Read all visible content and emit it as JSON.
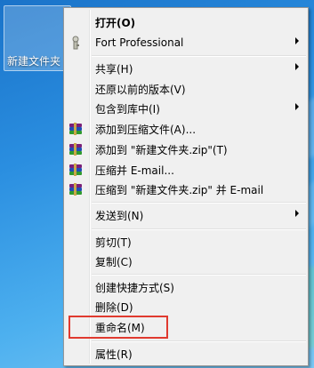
{
  "desktop": {
    "folder_label": "新建文件夹"
  },
  "menu": {
    "open": "打开(O)",
    "fort": "Fort Professional",
    "share": "共享(H)",
    "restore": "还原以前的版本(V)",
    "include_library": "包含到库中(I)",
    "add_archive": "添加到压缩文件(A)...",
    "add_zip": "添加到 \"新建文件夹.zip\"(T)",
    "compress_email": "压缩并 E-mail...",
    "compress_zip_email": "压缩到 \"新建文件夹.zip\" 并 E-mail",
    "send_to": "发送到(N)",
    "cut": "剪切(T)",
    "copy": "复制(C)",
    "create_shortcut": "创建快捷方式(S)",
    "delete": "删除(D)",
    "rename": "重命名(M)",
    "properties": "属性(R)"
  },
  "icons": {
    "fort": "fort-icon",
    "winrar": "winrar-archive-icon",
    "submenu": "chevron-right-icon"
  },
  "colors": {
    "highlight_box": "#e03a2f",
    "menu_background": "#f0f0f0"
  }
}
